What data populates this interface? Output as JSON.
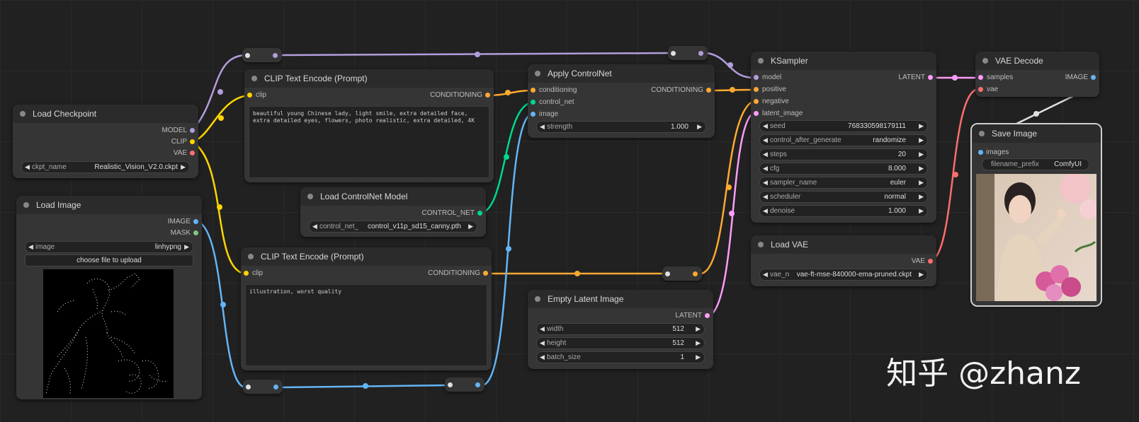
{
  "colors": {
    "model": "#b39ddb",
    "clip": "#ffd500",
    "vae": "#ff6e6e",
    "conditioning": "#ffa931",
    "image": "#64b5f6",
    "mask": "#81c784",
    "control_net": "#00d78d",
    "latent": "#ff9cf9",
    "white": "#e0e0e0"
  },
  "nodes": {
    "load_checkpoint": {
      "title": "Load Checkpoint",
      "outputs": [
        "MODEL",
        "CLIP",
        "VAE"
      ],
      "ckpt_label": "ckpt_name",
      "ckpt_value": "Realistic_Vision_V2.0.ckpt"
    },
    "load_image": {
      "title": "Load Image",
      "outputs": [
        "IMAGE",
        "MASK"
      ],
      "image_label": "image",
      "image_value": "linhypng",
      "upload_button": "choose file to upload"
    },
    "clip_pos": {
      "title": "CLIP Text Encode (Prompt)",
      "input": "clip",
      "output": "CONDITIONING",
      "text": "beautiful young Chinese lady, light smile, extra detailed face, extra detailed eyes, flowers, photo realistic, extra detailed, 4K"
    },
    "clip_neg": {
      "title": "CLIP Text Encode (Prompt)",
      "input": "clip",
      "output": "CONDITIONING",
      "text": "illustration, worst quality"
    },
    "controlnet_loader": {
      "title": "Load ControlNet Model",
      "output": "CONTROL_NET",
      "label": "control_net_",
      "value": "control_v11p_sd15_canny.pth"
    },
    "apply_controlnet": {
      "title": "Apply ControlNet",
      "inputs": [
        "conditioning",
        "control_net",
        "image"
      ],
      "output": "CONDITIONING",
      "strength_label": "strength",
      "strength_value": "1.000"
    },
    "empty_latent": {
      "title": "Empty Latent Image",
      "output": "LATENT",
      "widgets": [
        {
          "label": "width",
          "value": "512"
        },
        {
          "label": "height",
          "value": "512"
        },
        {
          "label": "batch_size",
          "value": "1"
        }
      ]
    },
    "ksampler": {
      "title": "KSampler",
      "inputs": [
        "model",
        "positive",
        "negative",
        "latent_image"
      ],
      "output": "LATENT",
      "widgets": [
        {
          "label": "seed",
          "value": "768330598179111"
        },
        {
          "label": "control_after_generate",
          "value": "randomize"
        },
        {
          "label": "steps",
          "value": "20"
        },
        {
          "label": "cfg",
          "value": "8.000"
        },
        {
          "label": "sampler_name",
          "value": "euler"
        },
        {
          "label": "scheduler",
          "value": "normal"
        },
        {
          "label": "denoise",
          "value": "1.000"
        }
      ]
    },
    "load_vae": {
      "title": "Load VAE",
      "output": "VAE",
      "label": "vae_n",
      "value": "vae-ft-mse-840000-ema-pruned.ckpt"
    },
    "vae_decode": {
      "title": "VAE Decode",
      "inputs": [
        "samples",
        "vae"
      ],
      "output": "IMAGE"
    },
    "save_image": {
      "title": "Save Image",
      "input": "images",
      "prefix_label": "filename_prefix",
      "prefix_value": "ComfyUI"
    }
  },
  "watermark": "知乎 @zhanz"
}
